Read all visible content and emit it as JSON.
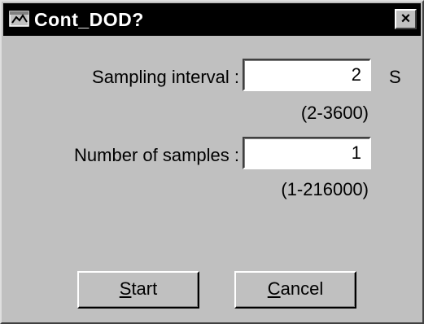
{
  "window": {
    "title": "Cont_DOD?",
    "close_glyph": "×"
  },
  "form": {
    "sampling_interval": {
      "label": "Sampling interval :",
      "value": "2",
      "unit": "S",
      "range": "(2-3600)"
    },
    "number_of_samples": {
      "label": "Number of samples :",
      "value": "1",
      "range": "(1-216000)"
    }
  },
  "buttons": {
    "start": {
      "accel": "S",
      "rest": "tart"
    },
    "cancel": {
      "accel": "C",
      "rest": "ancel"
    }
  },
  "icons": {
    "title": "app-window-icon",
    "close": "close-icon"
  }
}
